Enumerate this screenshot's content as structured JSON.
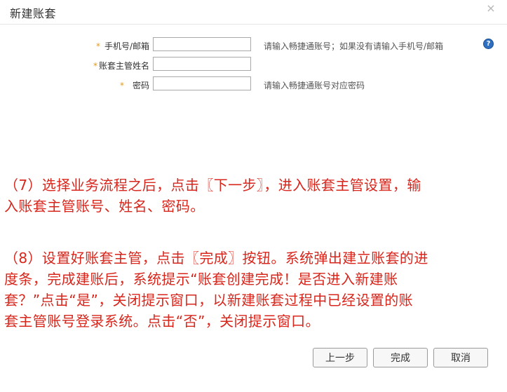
{
  "dialog": {
    "title": "新建账套",
    "close_glyph": "×",
    "help_glyph": "?"
  },
  "form": {
    "required_mark": "*",
    "fields": [
      {
        "label": "手机号/邮箱",
        "value": "",
        "hint": "请输入畅捷通账号；如果没有请输入手机号/邮箱"
      },
      {
        "label": "账套主管姓名",
        "value": "",
        "hint": ""
      },
      {
        "label": "密码",
        "value": "",
        "hint": "请输入畅捷通账号对应密码"
      }
    ]
  },
  "annotations": {
    "para1_line1": "（7）选择业务流程之后，点击〖下一步〗，进入账套主管设置，输",
    "para1_line2": "入账套主管账号、姓名、密码。",
    "para2_line1": "（8）设置好账套主管，点击〖完成〗按钮。系统弹出建立账套的进",
    "para2_line2": "度条，完成建账后，系统提示“账套创建完成！是否进入新建账",
    "para2_line3": "套？”点击“是”，关闭提示窗口，以新建账套过程中已经设置的账",
    "para2_line4": "套主管账号登录系统。点击“否”，关闭提示窗口。",
    "color": "#d7261c"
  },
  "buttons": {
    "prev": "上一步",
    "finish": "完成",
    "cancel": "取消"
  }
}
